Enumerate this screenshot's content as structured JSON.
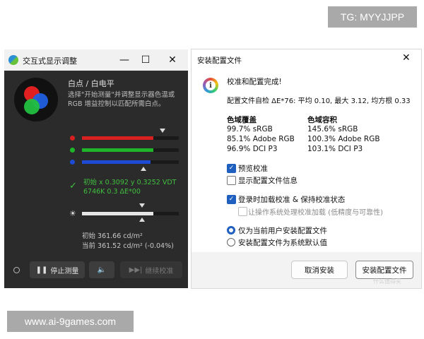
{
  "watermarks": {
    "top": "TG: MYYJJPP",
    "bottom": "www.ai-9games.com"
  },
  "left_window": {
    "title": "交互式显示调整",
    "section_title": "白点 / 白电平",
    "description": "选择\"开始测量\"并调整显示器色温或RGB 增益控制以匹配所需白点。",
    "result_line1": "初始 x 0.3092 y 0.3252 VDT",
    "result_line2": "6746K 0.3 ΔE*00",
    "luminance_initial": "初始 361.66 cd/m²",
    "luminance_current": "当前 361.52 cd/m² (-0.04%)",
    "sliders": {
      "red": 0.74,
      "green": 0.74,
      "blue": 0.71,
      "brightness": 0.74
    },
    "buttons": {
      "stop": "停止测量",
      "continue": "继续校准"
    },
    "colors": {
      "red": "#d92020",
      "green": "#1fb52a",
      "blue": "#1d4bd6",
      "success": "#3fc03f"
    }
  },
  "right_window": {
    "title": "安装配置文件",
    "heading": "校准和配置完成!",
    "self_check": "配置文件自检 ΔE*76: 平均 0.10, 最大 3.12, 均方根 0.33",
    "gamut_coverage": {
      "header": "色域覆盖",
      "rows": [
        "99.7% sRGB",
        "85.1% Adobe RGB",
        "96.9% DCI P3"
      ]
    },
    "gamut_volume": {
      "header": "色域容积",
      "rows": [
        "145.6% sRGB",
        "100.3% Adobe RGB",
        "103.1% DCI P3"
      ]
    },
    "options": {
      "preview": "预览校准",
      "show_info": "显示配置文件信息",
      "load_on_login": "登录时加载校准 & 保持校准状态",
      "os_handle": "让操作系统处理校准加载 (低精度与可靠性)",
      "current_user": "仅为当前用户安装配置文件",
      "system_default": "安装配置文件为系统默认值"
    },
    "buttons": {
      "cancel": "取消安装",
      "install": "安装配置文件"
    },
    "credit": "什么值得买"
  }
}
